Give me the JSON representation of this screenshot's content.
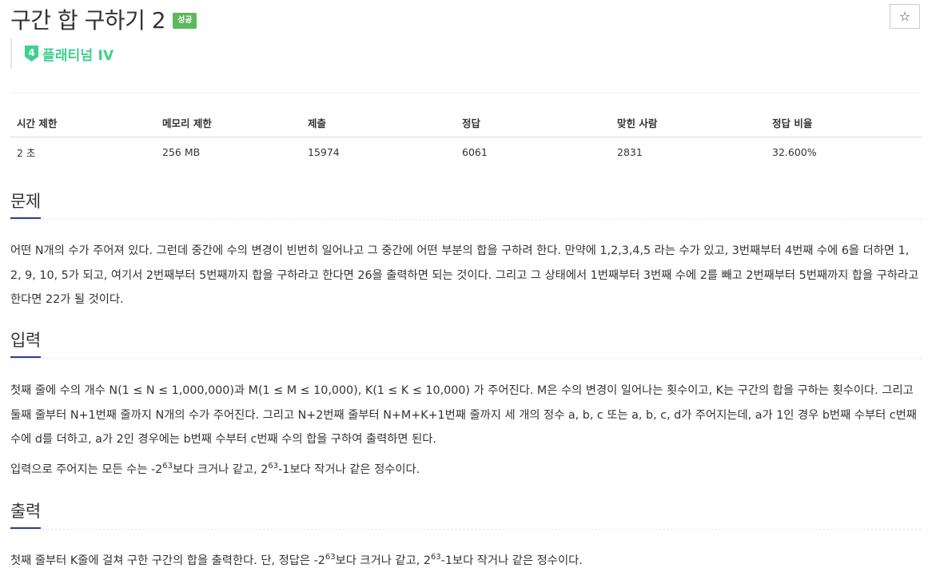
{
  "problem": {
    "title": "구간 합 구하기 2",
    "status_badge": "성공",
    "star_icon": "☆",
    "tier": {
      "number": "4",
      "label": "플래티넘 IV",
      "color": "#3ed08e"
    }
  },
  "info_table": {
    "headers": [
      "시간 제한",
      "메모리 제한",
      "제출",
      "정답",
      "맞힌 사람",
      "정답 비율"
    ],
    "values": [
      "2 초",
      "256 MB",
      "15974",
      "6061",
      "2831",
      "32.600%"
    ]
  },
  "sections": {
    "description": {
      "title": "문제",
      "text": "어떤 N개의 수가 주어져 있다. 그런데 중간에 수의 변경이 빈번히 일어나고 그 중간에 어떤 부분의 합을 구하려 한다. 만약에 1,2,3,4,5 라는 수가 있고, 3번째부터 4번째 수에 6을 더하면 1, 2, 9, 10, 5가 되고, 여기서 2번째부터 5번째까지 합을 구하라고 한다면 26을 출력하면 되는 것이다. 그리고 그 상태에서 1번째부터 3번째 수에 2를 빼고 2번째부터 5번째까지 합을 구하라고 한다면 22가 될 것이다."
    },
    "input": {
      "title": "입력",
      "text": "첫째 줄에 수의 개수 N(1 ≤ N ≤ 1,000,000)과 M(1 ≤ M ≤ 10,000), K(1 ≤ K ≤ 10,000) 가 주어진다. M은 수의 변경이 일어나는 횟수이고, K는 구간의 합을 구하는 횟수이다. 그리고 둘째 줄부터 N+1번째 줄까지 N개의 수가 주어진다. 그리고 N+2번째 줄부터 N+M+K+1번째 줄까지 세 개의 정수 a, b, c 또는 a, b, c, d가 주어지는데, a가 1인 경우 b번째 수부터 c번째 수에 d를 더하고, a가 2인 경우에는 b번째 수부터 c번째 수의 합을 구하여 출력하면 된다.",
      "range_parts": [
        "입력으로 주어지는 모든 수는 -2",
        "63",
        "보다 크거나 같고, 2",
        "63",
        "-1보다 작거나 같은 정수이다."
      ]
    },
    "output": {
      "title": "출력",
      "text_parts": [
        "첫째 줄부터 K줄에 걸쳐 구한 구간의 합을 출력한다. 단, 정답은 -2",
        "63",
        "보다 크거나 같고, 2",
        "63",
        "-1보다 작거나 같은 정수이다."
      ]
    }
  }
}
